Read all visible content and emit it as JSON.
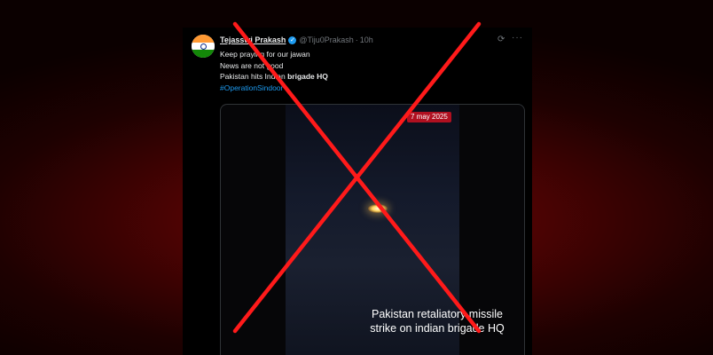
{
  "tweet": {
    "display_name": "Tejasswi Prakash",
    "verified_icon": "verified-badge-icon",
    "handle": "@Tiju0Prakash",
    "separator": "·",
    "time": "10h",
    "more_label": "···",
    "lines": [
      "Keep praying for our jawan",
      "News are not good"
    ],
    "line3_prefix": "Pakistan hits Indian ",
    "line3_bold": "brigade HQ",
    "hashtag": "#OperationSindoor"
  },
  "media": {
    "date_badge": "7 may 2025",
    "caption_line1": "Pakistan retaliatory missile",
    "caption_line2": "strike on indian brigade HQ"
  },
  "overlay": {
    "icon": "red-x-cross-icon",
    "color": "#ff1a1a"
  },
  "colors": {
    "background": "#4a0303",
    "card": "#000000",
    "text": "#e7e9ea",
    "muted": "#71767b",
    "link": "#1d9bf0",
    "badge": "#b01020"
  }
}
